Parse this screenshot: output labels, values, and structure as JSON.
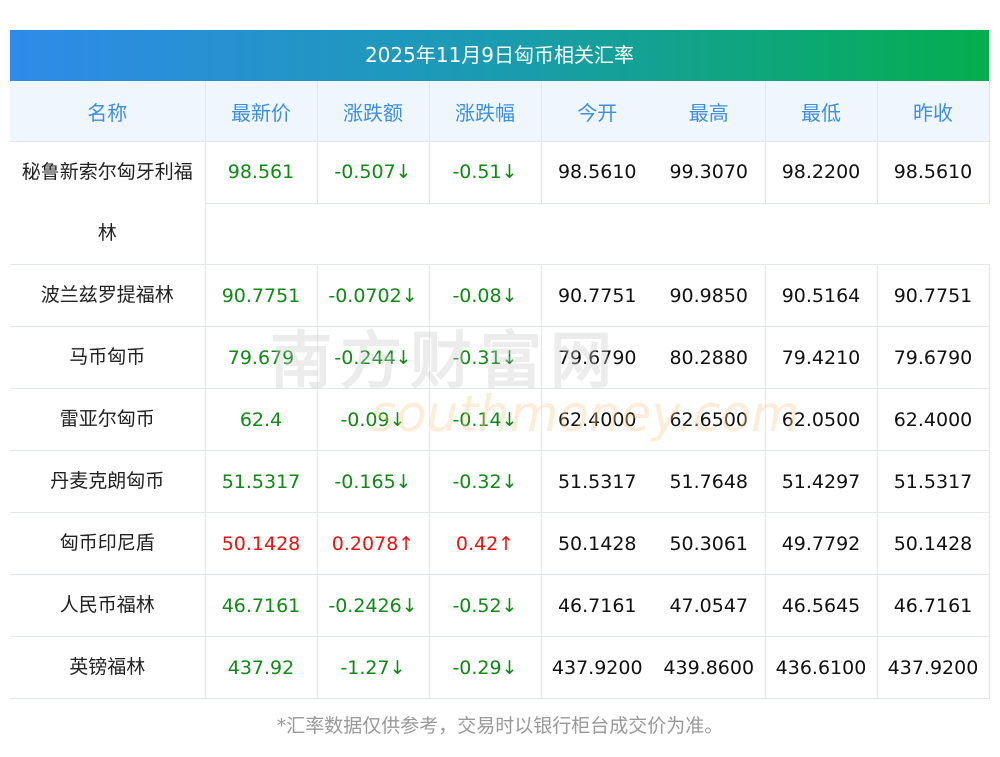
{
  "title": "2025年11月9日匈币相关汇率",
  "headers": [
    "名称",
    "最新价",
    "涨跌额",
    "涨跌幅",
    "今开",
    "最高",
    "最低",
    "昨收"
  ],
  "rows": [
    {
      "name": "秘鲁新索尔匈牙利福林",
      "latest": "98.561",
      "change": "-0.507↓",
      "pct": "-0.51↓",
      "open": "98.5610",
      "high": "99.3070",
      "low": "98.2200",
      "prev": "98.5610",
      "dir": "down"
    },
    {
      "name": "波兰兹罗提福林",
      "latest": "90.7751",
      "change": "-0.0702↓",
      "pct": "-0.08↓",
      "open": "90.7751",
      "high": "90.9850",
      "low": "90.5164",
      "prev": "90.7751",
      "dir": "down"
    },
    {
      "name": "马币匈币",
      "latest": "79.679",
      "change": "-0.244↓",
      "pct": "-0.31↓",
      "open": "79.6790",
      "high": "80.2880",
      "low": "79.4210",
      "prev": "79.6790",
      "dir": "down"
    },
    {
      "name": "雷亚尔匈币",
      "latest": "62.4",
      "change": "-0.09↓",
      "pct": "-0.14↓",
      "open": "62.4000",
      "high": "62.6500",
      "low": "62.0500",
      "prev": "62.4000",
      "dir": "down"
    },
    {
      "name": "丹麦克朗匈币",
      "latest": "51.5317",
      "change": "-0.165↓",
      "pct": "-0.32↓",
      "open": "51.5317",
      "high": "51.7648",
      "low": "51.4297",
      "prev": "51.5317",
      "dir": "down"
    },
    {
      "name": "匈币印尼盾",
      "latest": "50.1428",
      "change": "0.2078↑",
      "pct": "0.42↑",
      "open": "50.1428",
      "high": "50.3061",
      "low": "49.7792",
      "prev": "50.1428",
      "dir": "up"
    },
    {
      "name": "人民币福林",
      "latest": "46.7161",
      "change": "-0.2426↓",
      "pct": "-0.52↓",
      "open": "46.7161",
      "high": "47.0547",
      "low": "46.5645",
      "prev": "46.7161",
      "dir": "down"
    },
    {
      "name": "英镑福林",
      "latest": "437.92",
      "change": "-1.27↓",
      "pct": "-0.29↓",
      "open": "437.9200",
      "high": "439.8600",
      "low": "436.6100",
      "prev": "437.9200",
      "dir": "down"
    }
  ],
  "watermark": "南方财富网 southmoney.com",
  "note": "*汇率数据仅供参考，交易时以银行柜台成交价为准。",
  "colors": {
    "up": "#f01010",
    "down": "#0f8a14",
    "header_text": "#3d8fe0"
  }
}
